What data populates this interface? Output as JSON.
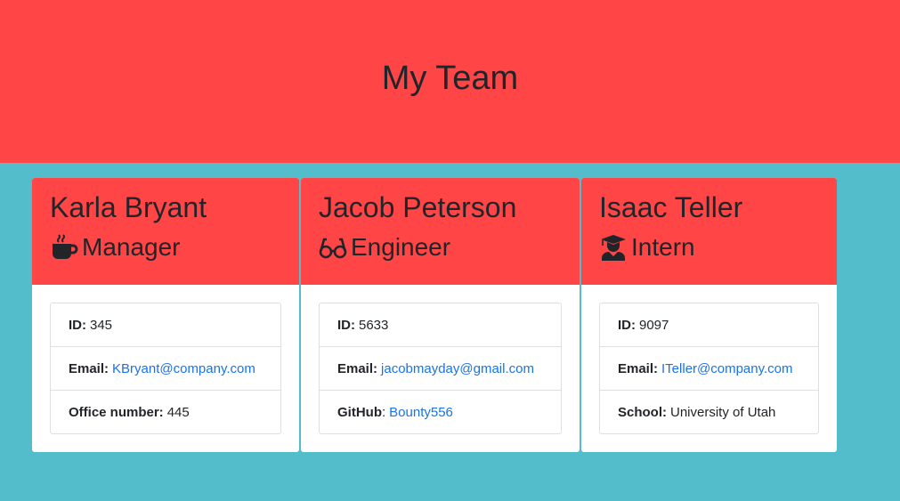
{
  "header": {
    "title": "My Team"
  },
  "cards": [
    {
      "name": "Karla Bryant",
      "role": "Manager",
      "role_icon": "coffee-mug-icon",
      "items": [
        {
          "label": "ID:",
          "value": "345"
        },
        {
          "label": "Email:",
          "value": "KBryant@company.com"
        },
        {
          "label": "Office number:",
          "value": "445"
        }
      ]
    },
    {
      "name": "Jacob Peterson",
      "role": "Engineer",
      "role_icon": "glasses-icon",
      "items": [
        {
          "label": "ID:",
          "value": "5633"
        },
        {
          "label": "Email:",
          "value": "jacobmayday@gmail.com"
        },
        {
          "label": "GitHub",
          "separator": ":",
          "value": "Bounty556"
        }
      ]
    },
    {
      "name": "Isaac Teller",
      "role": "Intern",
      "role_icon": "graduate-icon",
      "items": [
        {
          "label": "ID:",
          "value": "9097"
        },
        {
          "label": "Email:",
          "value": "ITeller@company.com"
        },
        {
          "label": "School:",
          "value": "University of Utah"
        }
      ]
    }
  ],
  "colors": {
    "header_bg": "#ff4545",
    "page_bg": "#53bdcb",
    "link": "#1a73e8"
  }
}
